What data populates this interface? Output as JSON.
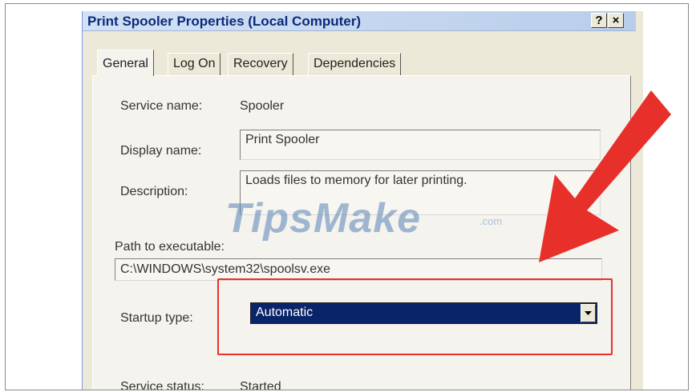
{
  "dialog": {
    "title": "Print Spooler Properties (Local Computer)",
    "help_button": "?",
    "close_button": "×"
  },
  "tabs": [
    {
      "label": "General"
    },
    {
      "label": "Log On"
    },
    {
      "label": "Recovery"
    },
    {
      "label": "Dependencies"
    }
  ],
  "general": {
    "service_name_label": "Service name:",
    "service_name_value": "Spooler",
    "display_name_label": "Display name:",
    "display_name_value": "Print Spooler",
    "description_label": "Description:",
    "description_value": "Loads files to memory for later printing.",
    "path_label": "Path to executable:",
    "path_value": "C:\\WINDOWS\\system32\\spoolsv.exe",
    "startup_type_label": "Startup type:",
    "startup_type_value": "Automatic",
    "service_status_label": "Service status:",
    "service_status_value": "Started"
  },
  "watermark": {
    "text": "TipsMake",
    "suffix": ".com"
  },
  "colors": {
    "annotation_red": "#e8302a",
    "selection_blue": "#0a246a"
  }
}
